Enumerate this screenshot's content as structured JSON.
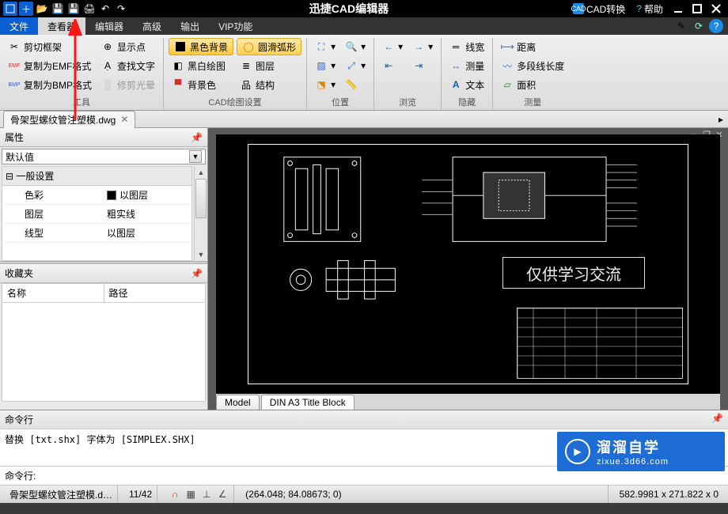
{
  "title": "迅捷CAD编辑器",
  "titlebar_right": {
    "convert": "CAD转换",
    "help": "帮助"
  },
  "menu": {
    "file": "文件",
    "viewer": "查看器",
    "editor": "编辑器",
    "advanced": "高级",
    "output": "输出",
    "vip": "VIP功能"
  },
  "ribbon": {
    "tool": {
      "title": "工具",
      "clip": "剪切框架",
      "copy_emf": "复制为EMF格式",
      "copy_bmp": "复制为BMP格式",
      "show_point": "显示点",
      "find_text": "查找文字",
      "trim_halo": "修剪光晕"
    },
    "cad": {
      "title": "CAD绘图设置",
      "black_bg": "黑色背景",
      "smooth_arc": "圆滑弧形",
      "bw_draw": "黑白绘图",
      "layer": "图层",
      "bg_color": "背景色",
      "structure": "结构"
    },
    "position": {
      "title": "位置"
    },
    "browse": {
      "title": "浏览"
    },
    "hide": {
      "title": "隐藏",
      "line_width": "线宽",
      "measure": "测量",
      "text": "文本"
    },
    "measure": {
      "title": "测量",
      "distance": "距离",
      "polyline": "多段线长度",
      "area": "面积"
    }
  },
  "doc_tab": "骨架型螺纹管注塑模.dwg",
  "properties": {
    "title": "属性",
    "combo": "默认值",
    "cat": "一般设置",
    "rows": {
      "color_k": "色彩",
      "color_v": "以图层",
      "layer_k": "图层",
      "layer_v": "粗实线",
      "ltype_k": "线型",
      "ltype_v": "以图层"
    }
  },
  "favorites": {
    "title": "收藏夹",
    "col_name": "名称",
    "col_path": "路径"
  },
  "model_tabs": {
    "model": "Model",
    "block": "DIN A3 Title Block"
  },
  "watermark": "仅供学习交流",
  "command": {
    "title": "命令行",
    "log": "替换 [txt.shx] 字体为 [SIMPLEX.SHX]",
    "prompt": "命令行:"
  },
  "status": {
    "file": "骨架型螺纹管注塑模.d…",
    "progress": "11/42",
    "coord": "(264.048; 84.08673; 0)",
    "size": "582.9981 x 271.822 x 0"
  },
  "logo": {
    "name": "溜溜自学",
    "url": "zixue.3d66.com"
  }
}
